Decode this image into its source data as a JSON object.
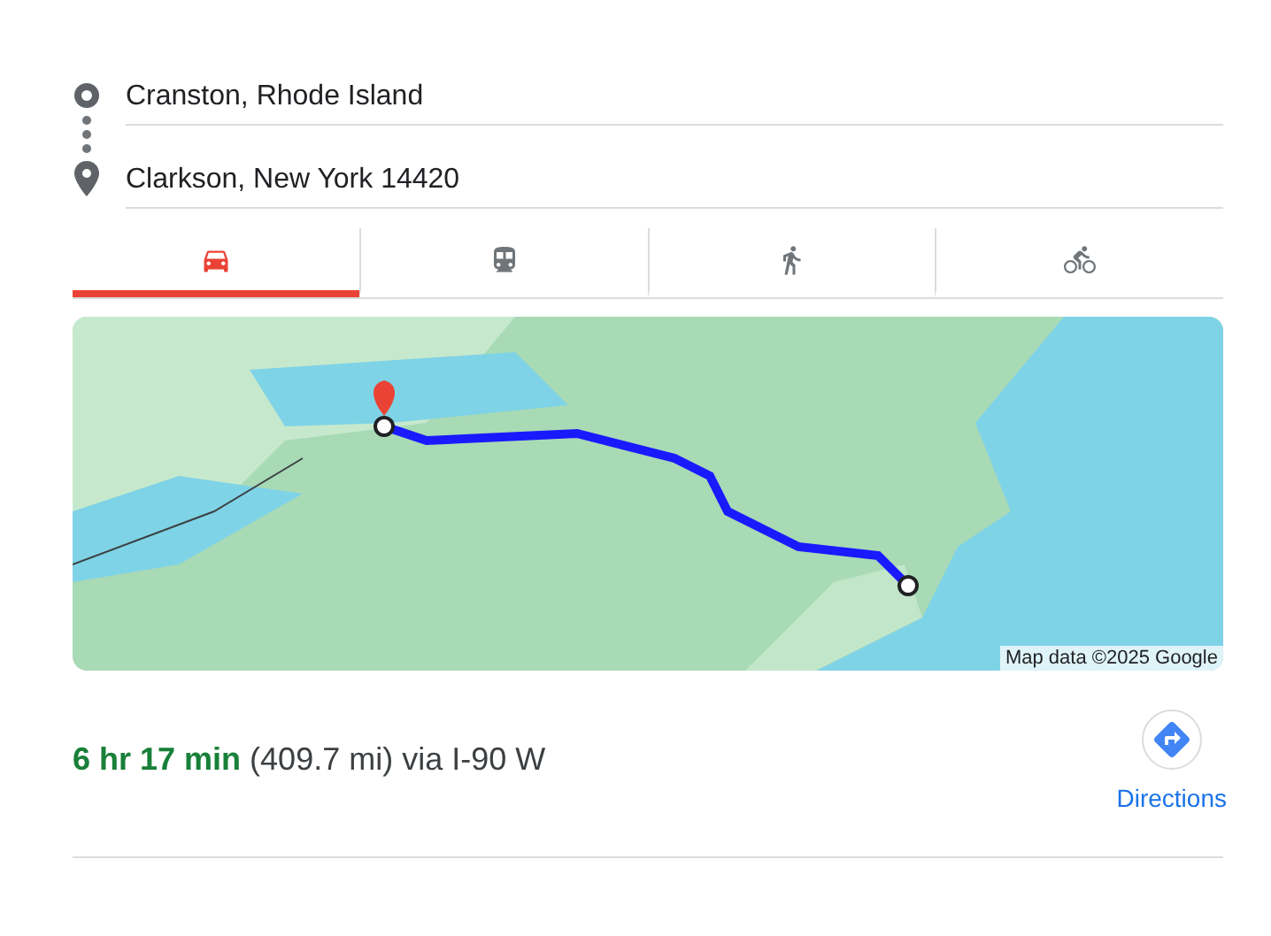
{
  "route": {
    "origin": "Cranston, Rhode Island",
    "destination": "Clarkson, New York 14420"
  },
  "modes": [
    {
      "kind": "car",
      "selected": true
    },
    {
      "kind": "transit",
      "selected": false
    },
    {
      "kind": "walk",
      "selected": false
    },
    {
      "kind": "bike",
      "selected": false
    }
  ],
  "map": {
    "kind": "picture",
    "attribution": "Map data ©2025 Google"
  },
  "summary": {
    "text": "**6 hr 17 min** (409.7 mi) via I-90 W"
  },
  "directions_button": {
    "label": "Directions"
  }
}
